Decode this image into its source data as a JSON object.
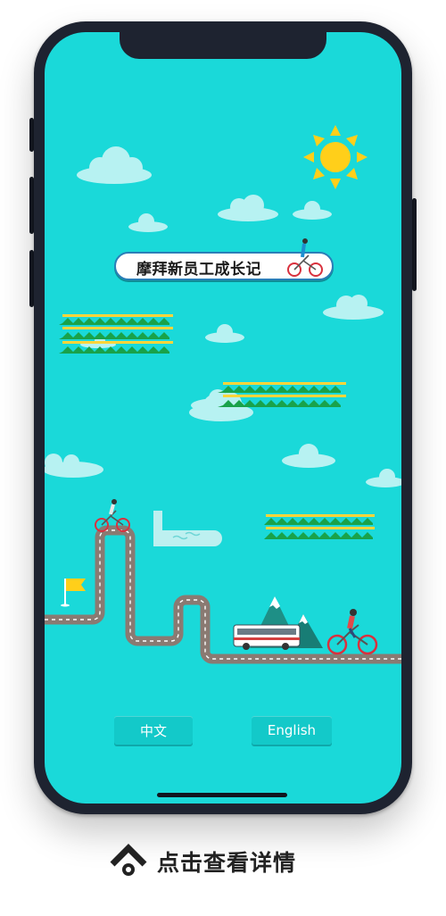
{
  "app": {
    "title": "摩拜新员工成长记"
  },
  "language": {
    "chinese_label": "中文",
    "english_label": "English"
  },
  "footer": {
    "caption": "点击查看详情",
    "icon": "arrow-up-icon"
  },
  "colors": {
    "sky": "#1ad9d9",
    "button": "#13c9c9",
    "road": "#8a7a72",
    "sun": "#ffcf1a",
    "frame": "#1e2330"
  }
}
